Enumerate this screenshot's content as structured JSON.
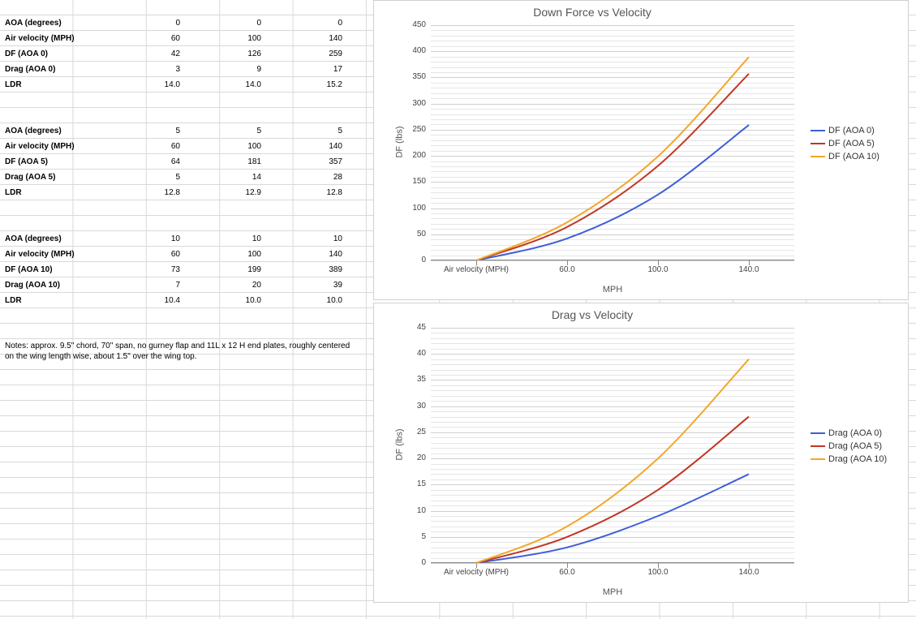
{
  "table": {
    "blocks": [
      {
        "rows": [
          {
            "label": "AOA (degrees)",
            "v": [
              "0",
              "0",
              "0"
            ]
          },
          {
            "label": "Air velocity (MPH)",
            "v": [
              "60",
              "100",
              "140"
            ]
          },
          {
            "label": "DF (AOA 0)",
            "v": [
              "42",
              "126",
              "259"
            ]
          },
          {
            "label": "Drag (AOA 0)",
            "v": [
              "3",
              "9",
              "17"
            ]
          },
          {
            "label": "LDR",
            "v": [
              "14.0",
              "14.0",
              "15.2"
            ]
          }
        ]
      },
      {
        "rows": [
          {
            "label": "AOA (degrees)",
            "v": [
              "5",
              "5",
              "5"
            ]
          },
          {
            "label": "Air velocity (MPH)",
            "v": [
              "60",
              "100",
              "140"
            ]
          },
          {
            "label": "DF (AOA 5)",
            "v": [
              "64",
              "181",
              "357"
            ]
          },
          {
            "label": "Drag (AOA 5)",
            "v": [
              "5",
              "14",
              "28"
            ]
          },
          {
            "label": "LDR",
            "v": [
              "12.8",
              "12.9",
              "12.8"
            ]
          }
        ]
      },
      {
        "rows": [
          {
            "label": "AOA (degrees)",
            "v": [
              "10",
              "10",
              "10"
            ]
          },
          {
            "label": "Air velocity (MPH)",
            "v": [
              "60",
              "100",
              "140"
            ]
          },
          {
            "label": "DF (AOA 10)",
            "v": [
              "73",
              "199",
              "389"
            ]
          },
          {
            "label": "Drag (AOA 10)",
            "v": [
              "7",
              "20",
              "39"
            ]
          },
          {
            "label": "LDR",
            "v": [
              "10.4",
              "10.0",
              "10.0"
            ]
          }
        ]
      }
    ],
    "notes": "Notes: approx. 9.5\" chord, 70\" span, no gurney flap and 11L x 12 H end plates, roughly centered on the wing length wise, about 1.5\" over the wing top."
  },
  "chart_data": [
    {
      "type": "line",
      "title": "Down Force vs Velocity",
      "xlabel": "MPH",
      "ylabel": "DF (lbs)",
      "xticks": [
        "Air velocity (MPH)",
        "60.0",
        "100.0",
        "140.0"
      ],
      "yticks": [
        0,
        50,
        100,
        150,
        200,
        250,
        300,
        350,
        400,
        450
      ],
      "ylim": [
        0,
        450
      ],
      "categories": [
        "Air velocity (MPH)",
        60,
        100,
        140
      ],
      "series": [
        {
          "name": "DF (AOA 0)",
          "color": "#3e5fd8",
          "values": [
            0,
            42,
            126,
            259
          ]
        },
        {
          "name": "DF (AOA 5)",
          "color": "#c13524",
          "values": [
            0,
            64,
            181,
            357
          ]
        },
        {
          "name": "DF (AOA 10)",
          "color": "#f2a728",
          "values": [
            0,
            73,
            199,
            389
          ]
        }
      ]
    },
    {
      "type": "line",
      "title": "Drag vs Velocity",
      "xlabel": "MPH",
      "ylabel": "DF (lbs)",
      "xticks": [
        "Air velocity (MPH)",
        "60.0",
        "100.0",
        "140.0"
      ],
      "yticks": [
        0,
        5,
        10,
        15,
        20,
        25,
        30,
        35,
        40,
        45
      ],
      "ylim": [
        0,
        45
      ],
      "categories": [
        "Air velocity (MPH)",
        60,
        100,
        140
      ],
      "series": [
        {
          "name": "Drag (AOA 0)",
          "color": "#3e5fd8",
          "values": [
            0,
            3,
            9,
            17
          ]
        },
        {
          "name": "Drag (AOA 5)",
          "color": "#c13524",
          "values": [
            0,
            5,
            14,
            28
          ]
        },
        {
          "name": "Drag (AOA 10)",
          "color": "#f2a728",
          "values": [
            0,
            7,
            20,
            39
          ]
        }
      ]
    }
  ],
  "colors": {
    "blue": "#3e5fd8",
    "red": "#c13524",
    "orange": "#f2a728"
  }
}
